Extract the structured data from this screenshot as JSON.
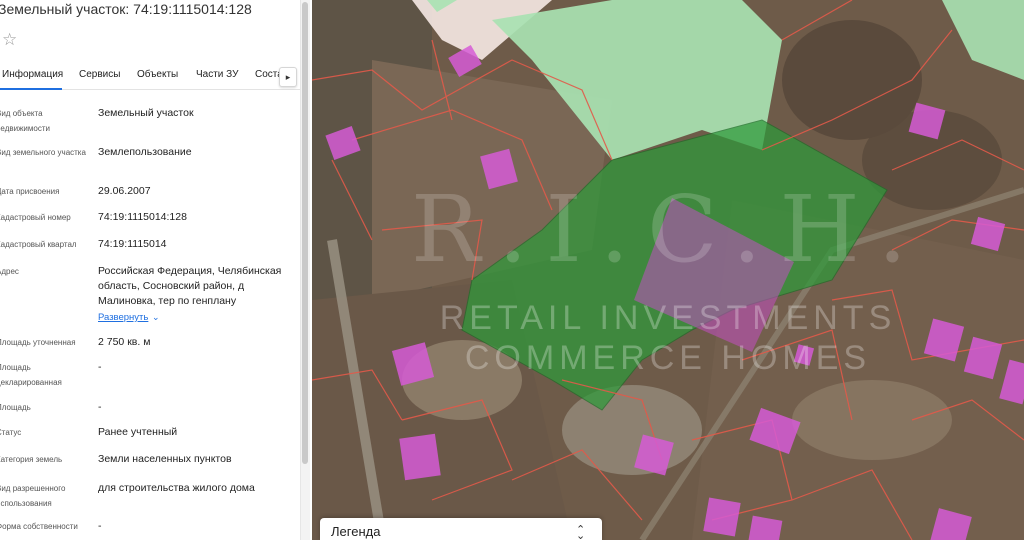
{
  "panel": {
    "title": "Земельный участок: 74:19:1115014:128",
    "favorite_icon": "star-icon",
    "tabs": [
      {
        "label": "Информация",
        "active": true
      },
      {
        "label": "Сервисы",
        "active": false
      },
      {
        "label": "Объекты",
        "active": false
      },
      {
        "label": "Части ЗУ",
        "active": false
      },
      {
        "label": "Соста",
        "active": false
      }
    ],
    "tabs_scroll_icon": "chevron-right-icon",
    "fields": [
      {
        "label": "Вид объекта недвижимости",
        "value": "Земельный участок"
      },
      {
        "label": "Вид земельного участка",
        "value": "Землепользование"
      },
      {
        "label": "Дата присвоения",
        "value": "29.06.2007"
      },
      {
        "label": "Кадастровый номер",
        "value": "74:19:1115014:128"
      },
      {
        "label": "Кадастровый квартал",
        "value": "74:19:1115014"
      },
      {
        "label": "Адрес",
        "value": "Российская Федерация, Челябинская область, Сосновский район, д Малиновка, тер по генплану"
      },
      {
        "label": "Площадь уточненная",
        "value": "2 750 кв. м"
      },
      {
        "label": "Площадь декларированная",
        "value": "-"
      },
      {
        "label": "Площадь",
        "value": "-"
      },
      {
        "label": "Статус",
        "value": "Ранее учтенный"
      },
      {
        "label": "Категория земель",
        "value": "Земли населенных пунктов"
      },
      {
        "label": "Вид разрешенного использования",
        "value": "для строительства жилого дома"
      },
      {
        "label": "Форма собственности",
        "value": "-"
      }
    ],
    "expand_label": "Развернуть"
  },
  "map": {
    "watermark_logo": "R.I.C.H.",
    "watermark_line1": "RETAIL INVESTMENTS",
    "watermark_line2": "COMMERCE HOMES",
    "legend_label": "Легенда",
    "legend_toggle_icon": "chevron-updown-icon",
    "colors": {
      "selected_parcel": "#2e9a3a",
      "neighbor_zone": "#a8e2b2",
      "building": "#d65bd6",
      "parcel_border": "#e25a4a"
    }
  }
}
